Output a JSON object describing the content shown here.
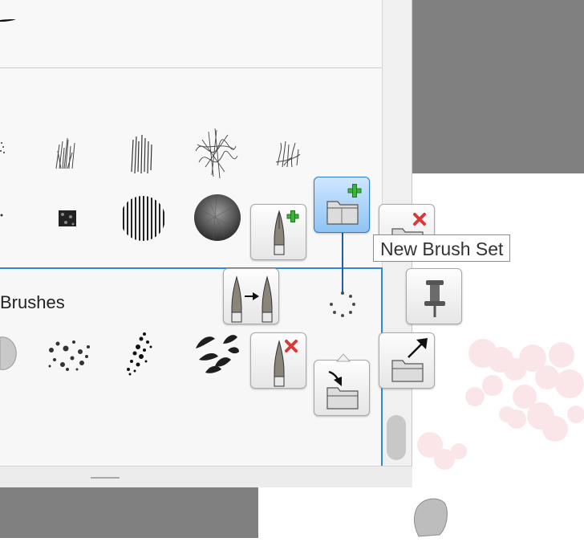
{
  "brush_panel": {
    "selected_set_label": "Brushes"
  },
  "tooltip": {
    "text": "New Brush Set"
  },
  "colors": {
    "selection_border": "#2c8ad8",
    "active_button": "#8ec4f3",
    "add_plus": "#3cb43c",
    "delete_x": "#d83a3a",
    "canvas_gray": "#808080"
  },
  "radial_buttons": [
    {
      "name": "new-brush-button",
      "icon": "pen-plus-icon"
    },
    {
      "name": "new-brush-set-button",
      "icon": "folder-plus-icon"
    },
    {
      "name": "delete-brush-set-button",
      "icon": "folder-x-icon"
    },
    {
      "name": "duplicate-brush-button",
      "icon": "pen-duplicate-icon"
    },
    {
      "name": "pin-panel-button",
      "icon": "pin-icon"
    },
    {
      "name": "delete-brush-button",
      "icon": "pen-x-icon"
    },
    {
      "name": "import-brush-set-button",
      "icon": "folder-import-icon"
    },
    {
      "name": "export-brush-set-button",
      "icon": "folder-export-icon"
    }
  ]
}
